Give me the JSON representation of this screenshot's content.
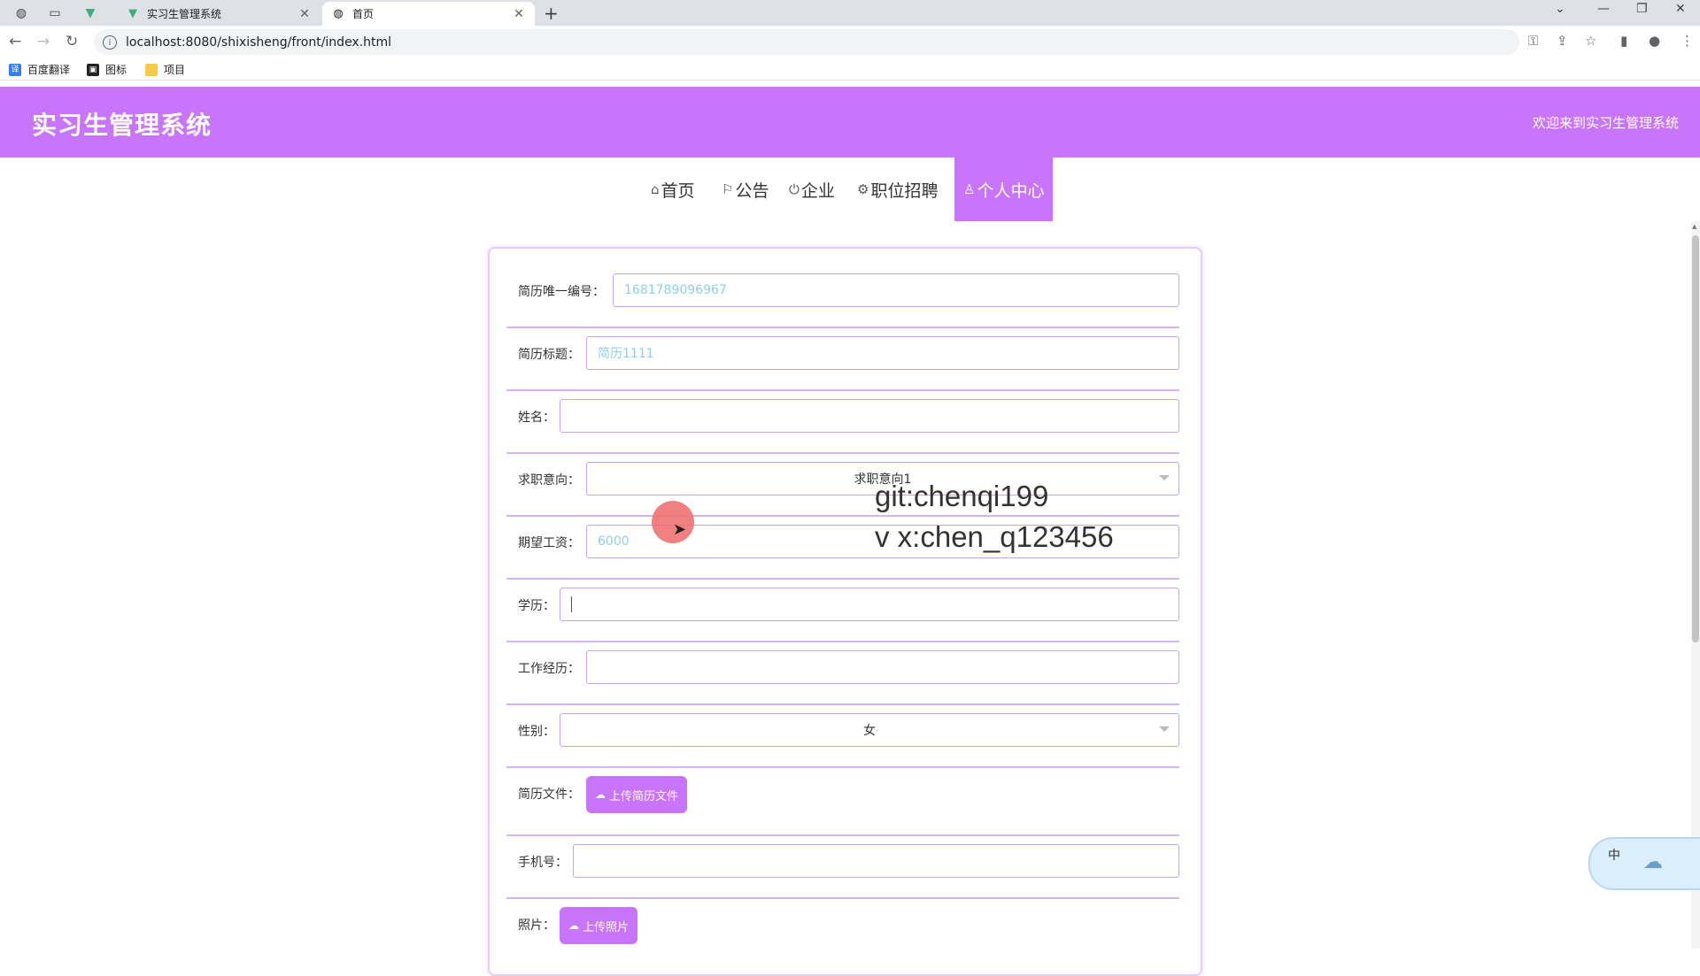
{
  "browser": {
    "tabs": [
      {
        "title": "实习生管理系统",
        "favicon": "vue-logo-icon",
        "active": false
      },
      {
        "title": "首页",
        "favicon": "globe-icon",
        "active": true
      }
    ],
    "new_tab": "+",
    "url": "localhost:8080/shixisheng/front/index.html",
    "bookmarks": [
      {
        "label": "百度翻译",
        "icon": "translate-icon"
      },
      {
        "label": "图标",
        "icon": "image-icon"
      },
      {
        "label": "项目",
        "icon": "folder-icon"
      }
    ]
  },
  "header": {
    "brand": "实习生管理系统",
    "welcome": "欢迎来到实习生管理系统",
    "accent_color": "#c875fb"
  },
  "nav": [
    {
      "label": "首页",
      "icon": "home-icon"
    },
    {
      "label": "公告",
      "icon": "flag-icon"
    },
    {
      "label": "企业",
      "icon": "power-icon"
    },
    {
      "label": "职位招聘",
      "icon": "gear-icon"
    },
    {
      "label": "个人中心",
      "icon": "user-icon",
      "active": true
    }
  ],
  "form": {
    "resume_id": {
      "label": "简历唯一编号：",
      "value": "1681789096967"
    },
    "resume_title": {
      "label": "简历标题：",
      "value": "简历1111"
    },
    "name": {
      "label": "姓名：",
      "value": ""
    },
    "intention": {
      "label": "求职意向：",
      "value": "求职意向1"
    },
    "salary": {
      "label": "期望工资：",
      "value": "6000"
    },
    "education": {
      "label": "学历：",
      "value": ""
    },
    "experience": {
      "label": "工作经历：",
      "value": ""
    },
    "gender": {
      "label": "性别：",
      "value": "女"
    },
    "resume_file": {
      "label": "简历文件：",
      "button": "上传简历文件"
    },
    "phone": {
      "label": "手机号：",
      "value": ""
    },
    "photo": {
      "label": "照片：",
      "button": "上传照片"
    }
  },
  "watermark": {
    "line1": "git:chenqi199",
    "line2": "v x:chen_q123456"
  },
  "ime": {
    "label": "中"
  }
}
